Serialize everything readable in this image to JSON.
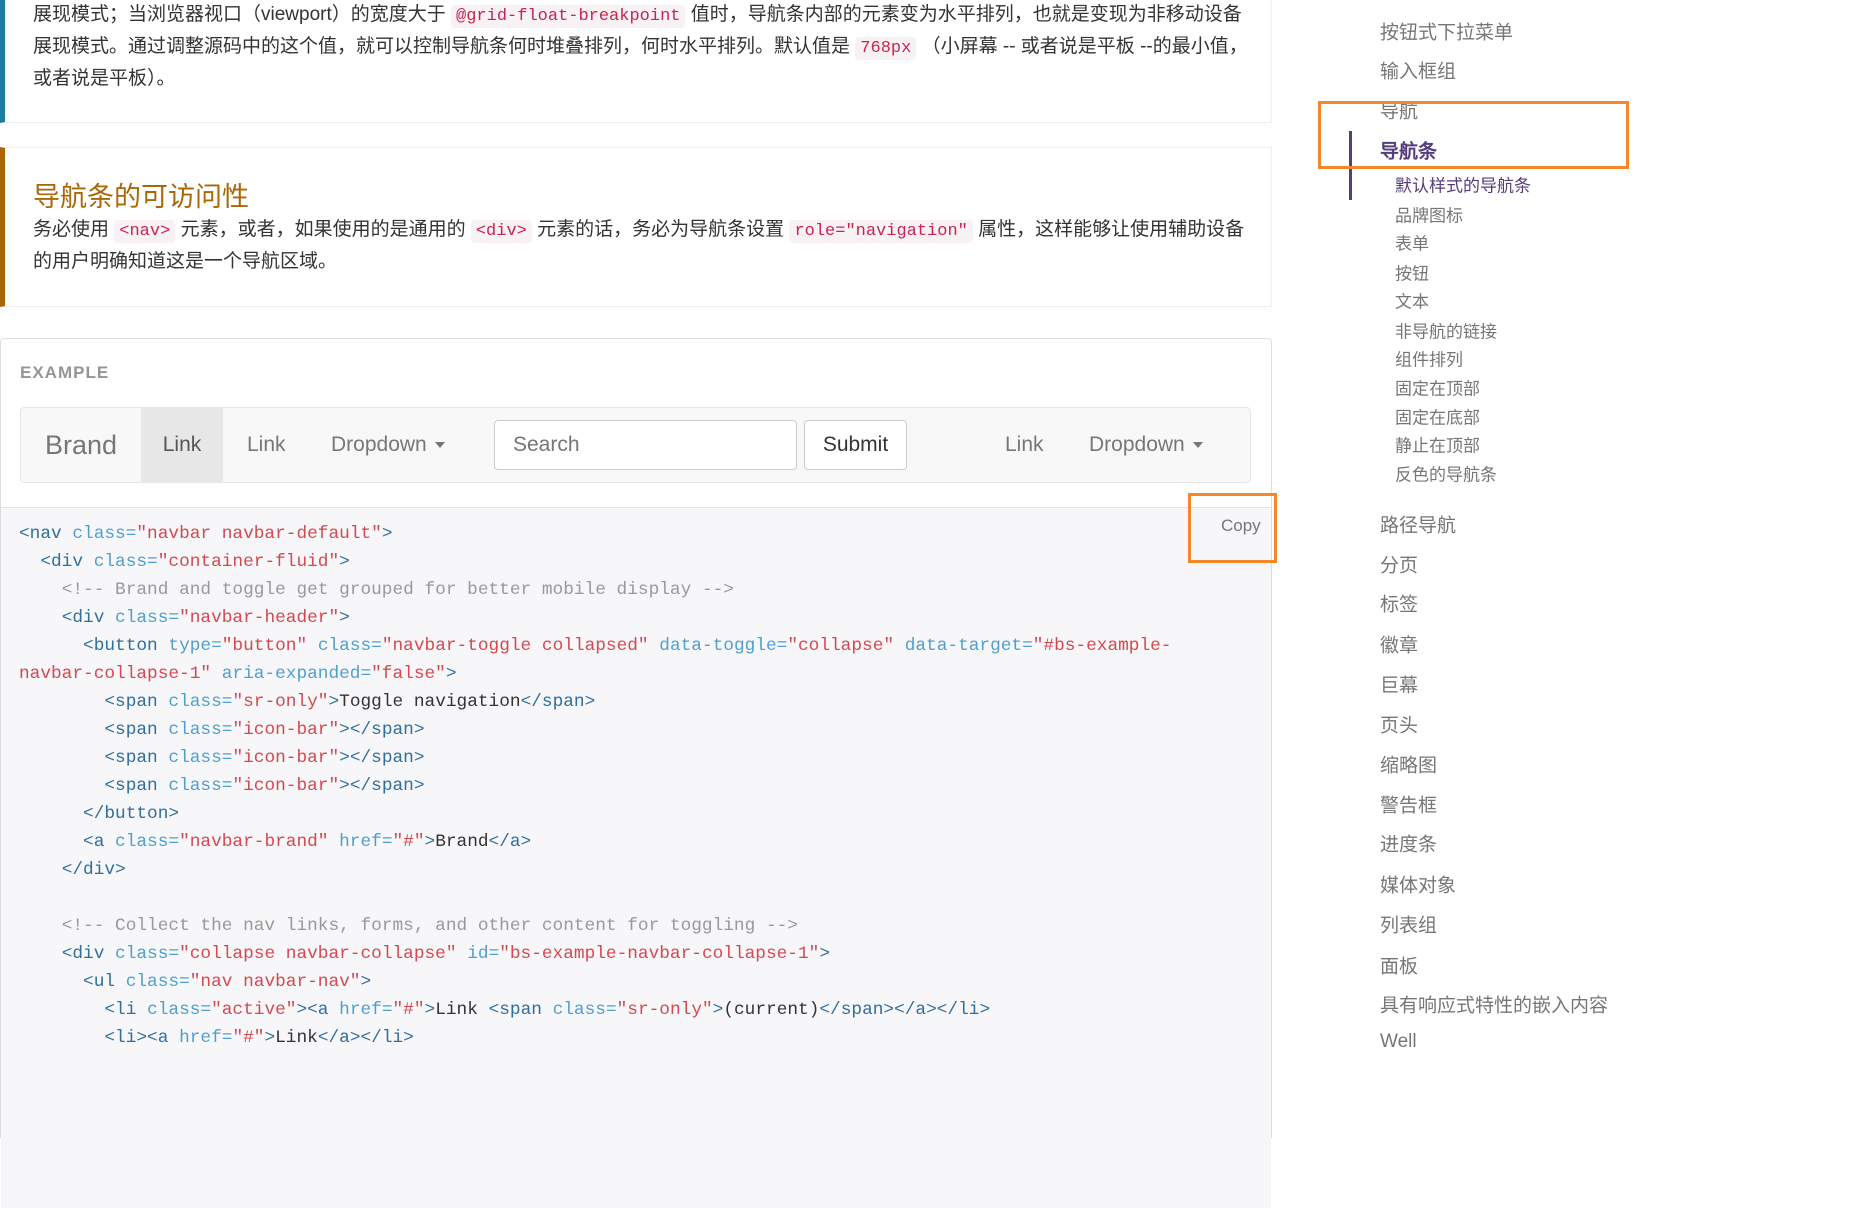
{
  "callout_breakpoint": {
    "text_parts": [
      "展现模式；当浏览器视口（viewport）的宽度大于 ",
      "@grid-float-breakpoint",
      " 值时，导航条内部的元素变为水平排列，也就是变现为非移动设备展现模式。通过调整源码中的这个值，就可以控制导航条何时堆叠排列，何时水平排列。默认值是 ",
      "768px",
      " （小屏幕 -- 或者说是平板 --的最小值，或者说是平板）。"
    ]
  },
  "callout_accessibility": {
    "title": "导航条的可访问性",
    "text_parts": [
      "务必使用 ",
      "<nav>",
      " 元素，或者，如果使用的是通用的 ",
      "<div>",
      " 元素的话，务必为导航条设置 ",
      "role=\"navigation\"",
      " 属性，这样能够让使用辅助设备的用户明确知道这是一个导航区域。"
    ]
  },
  "example": {
    "label": "EXAMPLE",
    "navbar": {
      "brand": "Brand",
      "link_active": "Link",
      "link2": "Link",
      "dropdown1": "Dropdown",
      "search_placeholder": "Search",
      "submit": "Submit",
      "link_right": "Link",
      "dropdown_right": "Dropdown"
    },
    "copy_label": "Copy",
    "code_lines": [
      [
        [
          "nt",
          "<nav "
        ],
        [
          "na",
          "class="
        ],
        [
          "s",
          "\"navbar navbar-default\""
        ],
        [
          "nt",
          ">"
        ]
      ],
      [
        [
          "t",
          "  "
        ],
        [
          "nt",
          "<div "
        ],
        [
          "na",
          "class="
        ],
        [
          "s",
          "\"container-fluid\""
        ],
        [
          "nt",
          ">"
        ]
      ],
      [
        [
          "t",
          "    "
        ],
        [
          "c",
          "<!-- Brand and toggle get grouped for better mobile display -->"
        ]
      ],
      [
        [
          "t",
          "    "
        ],
        [
          "nt",
          "<div "
        ],
        [
          "na",
          "class="
        ],
        [
          "s",
          "\"navbar-header\""
        ],
        [
          "nt",
          ">"
        ]
      ],
      [
        [
          "t",
          "      "
        ],
        [
          "nt",
          "<button "
        ],
        [
          "na",
          "type="
        ],
        [
          "s",
          "\"button\""
        ],
        [
          "t",
          " "
        ],
        [
          "na",
          "class="
        ],
        [
          "s",
          "\"navbar-toggle collapsed\""
        ],
        [
          "t",
          " "
        ],
        [
          "na",
          "data-toggle="
        ],
        [
          "s",
          "\"collapse\""
        ],
        [
          "t",
          " "
        ],
        [
          "na",
          "data-target="
        ],
        [
          "s",
          "\"#bs-example-"
        ]
      ],
      [
        [
          "s",
          "navbar-collapse-1\""
        ],
        [
          "t",
          " "
        ],
        [
          "na",
          "aria-expanded="
        ],
        [
          "s",
          "\"false\""
        ],
        [
          "nt",
          ">"
        ]
      ],
      [
        [
          "t",
          "        "
        ],
        [
          "nt",
          "<span "
        ],
        [
          "na",
          "class="
        ],
        [
          "s",
          "\"sr-only\""
        ],
        [
          "nt",
          ">"
        ],
        [
          "t",
          "Toggle navigation"
        ],
        [
          "nt",
          "</span>"
        ]
      ],
      [
        [
          "t",
          "        "
        ],
        [
          "nt",
          "<span "
        ],
        [
          "na",
          "class="
        ],
        [
          "s",
          "\"icon-bar\""
        ],
        [
          "nt",
          "></span>"
        ]
      ],
      [
        [
          "t",
          "        "
        ],
        [
          "nt",
          "<span "
        ],
        [
          "na",
          "class="
        ],
        [
          "s",
          "\"icon-bar\""
        ],
        [
          "nt",
          "></span>"
        ]
      ],
      [
        [
          "t",
          "        "
        ],
        [
          "nt",
          "<span "
        ],
        [
          "na",
          "class="
        ],
        [
          "s",
          "\"icon-bar\""
        ],
        [
          "nt",
          "></span>"
        ]
      ],
      [
        [
          "t",
          "      "
        ],
        [
          "nt",
          "</button>"
        ]
      ],
      [
        [
          "t",
          "      "
        ],
        [
          "nt",
          "<a "
        ],
        [
          "na",
          "class="
        ],
        [
          "s",
          "\"navbar-brand\""
        ],
        [
          "t",
          " "
        ],
        [
          "na",
          "href="
        ],
        [
          "s",
          "\"#\""
        ],
        [
          "nt",
          ">"
        ],
        [
          "t",
          "Brand"
        ],
        [
          "nt",
          "</a>"
        ]
      ],
      [
        [
          "t",
          "    "
        ],
        [
          "nt",
          "</div>"
        ]
      ],
      [
        [
          "t",
          ""
        ]
      ],
      [
        [
          "t",
          "    "
        ],
        [
          "c",
          "<!-- Collect the nav links, forms, and other content for toggling -->"
        ]
      ],
      [
        [
          "t",
          "    "
        ],
        [
          "nt",
          "<div "
        ],
        [
          "na",
          "class="
        ],
        [
          "s",
          "\"collapse navbar-collapse\""
        ],
        [
          "t",
          " "
        ],
        [
          "na",
          "id="
        ],
        [
          "s",
          "\"bs-example-navbar-collapse-1\""
        ],
        [
          "nt",
          ">"
        ]
      ],
      [
        [
          "t",
          "      "
        ],
        [
          "nt",
          "<ul "
        ],
        [
          "na",
          "class="
        ],
        [
          "s",
          "\"nav navbar-nav\""
        ],
        [
          "nt",
          ">"
        ]
      ],
      [
        [
          "t",
          "        "
        ],
        [
          "nt",
          "<li "
        ],
        [
          "na",
          "class="
        ],
        [
          "s",
          "\"active\""
        ],
        [
          "nt",
          "><a "
        ],
        [
          "na",
          "href="
        ],
        [
          "s",
          "\"#\""
        ],
        [
          "nt",
          ">"
        ],
        [
          "t",
          "Link "
        ],
        [
          "nt",
          "<span "
        ],
        [
          "na",
          "class="
        ],
        [
          "s",
          "\"sr-only\""
        ],
        [
          "nt",
          ">"
        ],
        [
          "t",
          "(current)"
        ],
        [
          "nt",
          "</span></a></li>"
        ]
      ],
      [
        [
          "t",
          "        "
        ],
        [
          "nt",
          "<li><a "
        ],
        [
          "na",
          "href="
        ],
        [
          "s",
          "\"#\""
        ],
        [
          "nt",
          ">"
        ],
        [
          "t",
          "Link"
        ],
        [
          "nt",
          "</a></li>"
        ]
      ]
    ]
  },
  "sidebar": {
    "items": [
      {
        "label": "按钮式下拉菜单",
        "level": 1
      },
      {
        "label": "输入框组",
        "level": 1
      },
      {
        "label": "导航",
        "level": 1
      },
      {
        "label": "导航条",
        "level": 1,
        "state": "active"
      },
      {
        "label": "默认样式的导航条",
        "level": 2,
        "state": "active"
      },
      {
        "label": "品牌图标",
        "level": 2
      },
      {
        "label": "表单",
        "level": 2
      },
      {
        "label": "按钮",
        "level": 2
      },
      {
        "label": "文本",
        "level": 2
      },
      {
        "label": "非导航的链接",
        "level": 2
      },
      {
        "label": "组件排列",
        "level": 2
      },
      {
        "label": "固定在顶部",
        "level": 2
      },
      {
        "label": "固定在底部",
        "level": 2
      },
      {
        "label": "静止在顶部",
        "level": 2
      },
      {
        "label": "反色的导航条",
        "level": 2
      },
      {
        "label": "路径导航",
        "level": 1
      },
      {
        "label": "分页",
        "level": 1
      },
      {
        "label": "标签",
        "level": 1
      },
      {
        "label": "徽章",
        "level": 1
      },
      {
        "label": "巨幕",
        "level": 1
      },
      {
        "label": "页头",
        "level": 1
      },
      {
        "label": "缩略图",
        "level": 1
      },
      {
        "label": "警告框",
        "level": 1
      },
      {
        "label": "进度条",
        "level": 1
      },
      {
        "label": "媒体对象",
        "level": 1
      },
      {
        "label": "列表组",
        "level": 1
      },
      {
        "label": "面板",
        "level": 1
      },
      {
        "label": "具有响应式特性的嵌入内容",
        "level": 1
      },
      {
        "label": "Well",
        "level": 1
      }
    ],
    "active_color": "#563d7c"
  },
  "highlight_color": "#f5862a"
}
